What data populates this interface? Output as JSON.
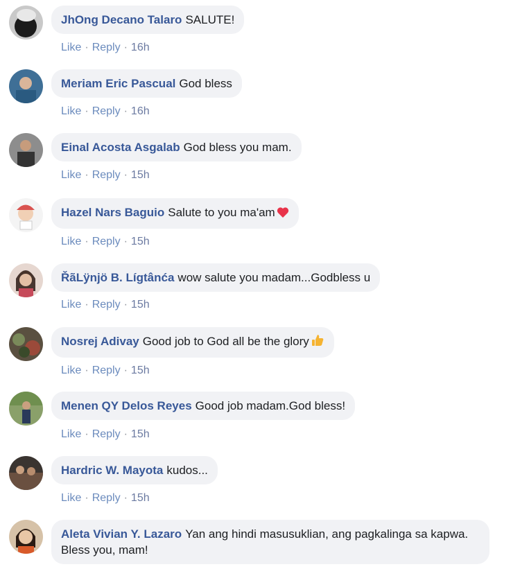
{
  "comments": [
    {
      "author": "JhOng Decano Talaro",
      "text": "SALUTE!",
      "like": "Like",
      "reply": "Reply",
      "time": "16h",
      "emoji": ""
    },
    {
      "author": "Meriam Eric Pascual",
      "text": "God bless",
      "like": "Like",
      "reply": "Reply",
      "time": "16h",
      "emoji": ""
    },
    {
      "author": "Einal Acosta Asgalab",
      "text": "God bless you mam.",
      "like": "Like",
      "reply": "Reply",
      "time": "15h",
      "emoji": ""
    },
    {
      "author": "Hazel Nars Baguio",
      "text": "Salute to you ma'am",
      "like": "Like",
      "reply": "Reply",
      "time": "15h",
      "emoji": "heart-icon"
    },
    {
      "author": "ŘãLÿnjö B. Lígtânća",
      "text": "wow salute you madam...Godbless u",
      "like": "Like",
      "reply": "Reply",
      "time": "15h",
      "emoji": ""
    },
    {
      "author": "Nosrej Adivay",
      "text": "Good job to God all be the glory",
      "like": "Like",
      "reply": "Reply",
      "time": "15h",
      "emoji": "thumbs-up-icon"
    },
    {
      "author": "Menen QY Delos Reyes",
      "text": "Good job madam.God bless!",
      "like": "Like",
      "reply": "Reply",
      "time": "15h",
      "emoji": ""
    },
    {
      "author": "Hardric W. Mayota",
      "text": "kudos...",
      "like": "Like",
      "reply": "Reply",
      "time": "15h",
      "emoji": ""
    },
    {
      "author": "Aleta Vivian Y. Lazaro",
      "text": "Yan ang hindi masusuklian, ang pagkalinga sa kapwa. Bless you, mam!",
      "like": "",
      "reply": "",
      "time": "",
      "emoji": ""
    }
  ],
  "colors": {
    "author": "#385898",
    "bubble": "#f1f2f5",
    "action": "#6b8bbd"
  }
}
